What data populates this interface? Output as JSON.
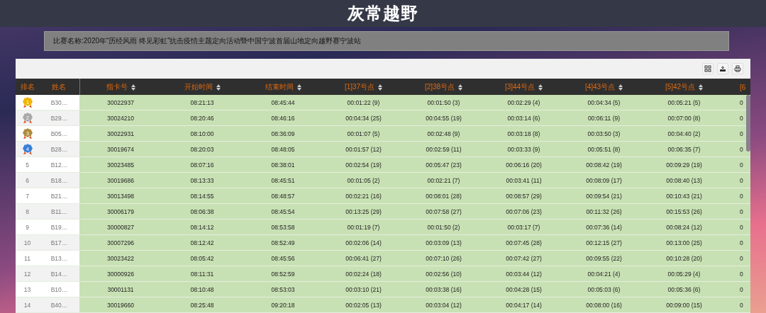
{
  "header": {
    "title": "灰常越野"
  },
  "competition": {
    "text": "比赛名称:2020年“历经风雨 终见彩虹”抗击疫情主题定向活动暨中国宁波首届山地定向越野赛宁波站"
  },
  "toolbar": {
    "buttons": [
      {
        "kind": "columns"
      },
      {
        "kind": "export"
      },
      {
        "kind": "print"
      }
    ]
  },
  "table": {
    "columns": [
      {
        "label": "排名",
        "sortable": false
      },
      {
        "label": "姓名",
        "sortable": false
      },
      {
        "label": "指卡号",
        "sortable": true
      },
      {
        "label": "开始时间",
        "sortable": true
      },
      {
        "label": "结束时间",
        "sortable": true
      },
      {
        "label": "[1]37号点",
        "sortable": true
      },
      {
        "label": "[2]38号点",
        "sortable": true
      },
      {
        "label": "[3]44号点",
        "sortable": true
      },
      {
        "label": "[4]43号点",
        "sortable": true
      },
      {
        "label": "[5]42号点",
        "sortable": true
      },
      {
        "label": "[6",
        "sortable": false
      }
    ],
    "rows": [
      {
        "kind": "medal",
        "color": "#f0b400",
        "cells": [
          "1",
          "B30…",
          "30022937",
          "08:21:13",
          "08:45:44",
          "00:01:22 (9)",
          "00:01:50 (3)",
          "00:02:29 (4)",
          "00:04:34 (5)",
          "00:05:21 (5)",
          "0"
        ]
      },
      {
        "kind": "medal",
        "color": "#a8a8a8",
        "cells": [
          "2",
          "B29…",
          "30024210",
          "08:20:46",
          "08:46:16",
          "00:04:34 (25)",
          "00:04:55 (19)",
          "00:03:14 (6)",
          "00:06:11 (9)",
          "00:07:00 (8)",
          "0"
        ]
      },
      {
        "kind": "medal",
        "color": "#b08a3a",
        "cells": [
          "3",
          "B05…",
          "30022931",
          "08:10:00",
          "08:36:09",
          "00:01:07 (5)",
          "00:02:48 (9)",
          "00:03:18 (8)",
          "00:03:50 (3)",
          "00:04:40 (2)",
          "0"
        ]
      },
      {
        "kind": "medal",
        "color": "#3a7fd8",
        "cells": [
          "4",
          "B28…",
          "30019674",
          "08:20:03",
          "08:48:05",
          "00:01:57 (12)",
          "00:02:59 (11)",
          "00:03:33 (9)",
          "00:05:51 (8)",
          "00:06:35 (7)",
          "0"
        ]
      },
      {
        "kind": "plain",
        "cells": [
          "5",
          "B12…",
          "30023485",
          "08:07:16",
          "08:38:01",
          "00:02:54 (19)",
          "00:05:47 (23)",
          "00:06:16 (20)",
          "00:08:42 (19)",
          "00:09:29 (19)",
          "0"
        ]
      },
      {
        "kind": "plain",
        "cells": [
          "6",
          "B18…",
          "30019686",
          "08:13:33",
          "08:45:51",
          "00:01:05 (2)",
          "00:02:21 (7)",
          "00:03:41 (11)",
          "00:08:09 (17)",
          "00:08:40 (13)",
          "0"
        ]
      },
      {
        "kind": "plain",
        "cells": [
          "7",
          "B21…",
          "30013498",
          "08:14:55",
          "08:48:57",
          "00:02:21 (16)",
          "00:08:01 (28)",
          "00:08:57 (29)",
          "00:09:54 (21)",
          "00:10:43 (21)",
          "0"
        ]
      },
      {
        "kind": "plain",
        "cells": [
          "8",
          "B11…",
          "30006179",
          "08:06:38",
          "08:45:54",
          "00:13:25 (29)",
          "00:07:58 (27)",
          "00:07:06 (23)",
          "00:11:32 (26)",
          "00:15:53 (26)",
          "0"
        ]
      },
      {
        "kind": "plain",
        "cells": [
          "9",
          "B19…",
          "30000827",
          "08:14:12",
          "08:53:58",
          "00:01:19 (7)",
          "00:01:50 (2)",
          "00:03:17 (7)",
          "00:07:36 (14)",
          "00:08:24 (12)",
          "0"
        ]
      },
      {
        "kind": "plain",
        "cells": [
          "10",
          "B17…",
          "30007296",
          "08:12:42",
          "08:52:49",
          "00:02:06 (14)",
          "00:03:09 (13)",
          "00:07:45 (28)",
          "00:12:15 (27)",
          "00:13:00 (25)",
          "0"
        ]
      },
      {
        "kind": "plain",
        "cells": [
          "11",
          "B13…",
          "30023422",
          "08:05:42",
          "08:45:56",
          "00:06:41 (27)",
          "00:07:10 (26)",
          "00:07:42 (27)",
          "00:09:55 (22)",
          "00:10:28 (20)",
          "0"
        ]
      },
      {
        "kind": "plain",
        "cells": [
          "12",
          "B14…",
          "30000926",
          "08:11:31",
          "08:52:59",
          "00:02:24 (18)",
          "00:02:56 (10)",
          "00:03:44 (12)",
          "00:04:21 (4)",
          "00:05:29 (4)",
          "0"
        ]
      },
      {
        "kind": "plain",
        "cells": [
          "13",
          "B10…",
          "30001131",
          "08:10:48",
          "08:53:03",
          "00:03:10 (21)",
          "00:03:38 (16)",
          "00:04:28 (15)",
          "00:05:03 (6)",
          "00:05:36 (6)",
          "0"
        ]
      },
      {
        "kind": "plain",
        "cells": [
          "14",
          "B40…",
          "30019660",
          "08:25:48",
          "09:20:18",
          "00:02:05 (13)",
          "00:03:04 (12)",
          "00:04:17 (14)",
          "00:08:00 (16)",
          "00:09:00 (15)",
          "0"
        ]
      }
    ]
  }
}
